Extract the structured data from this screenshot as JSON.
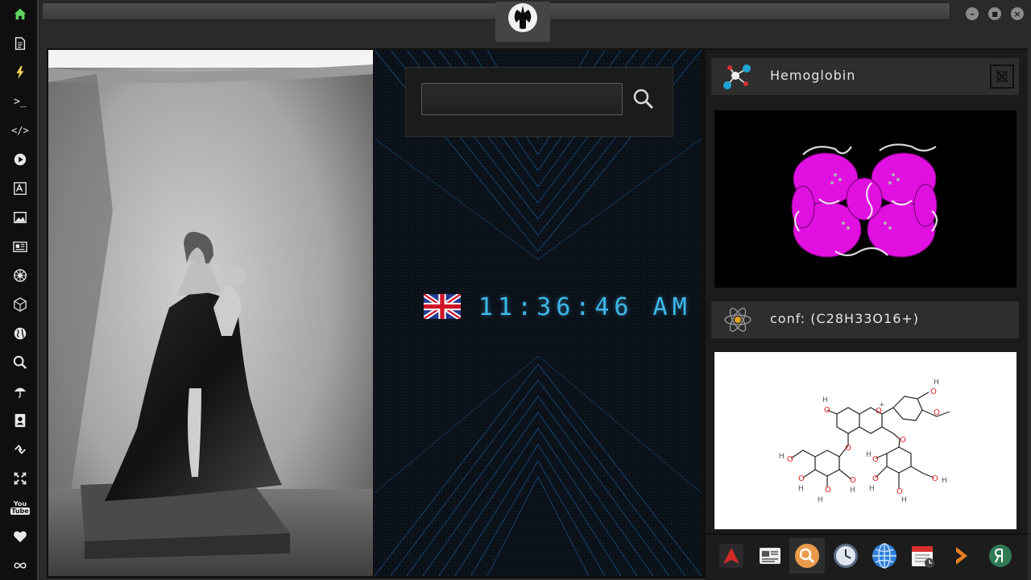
{
  "sidebar": {
    "items": [
      {
        "name": "home",
        "glyph": "⌂",
        "color": "#5fd35f"
      },
      {
        "name": "document",
        "glyph": "▤"
      },
      {
        "name": "bolt",
        "glyph": "⚡",
        "color": "#f2d35a"
      },
      {
        "name": "terminal",
        "glyph": ">_"
      },
      {
        "name": "code",
        "glyph": "</>"
      },
      {
        "name": "play",
        "glyph": "▶"
      },
      {
        "name": "translate",
        "glyph": "文"
      },
      {
        "name": "image",
        "glyph": "▣"
      },
      {
        "name": "news",
        "glyph": "☰"
      },
      {
        "name": "empire",
        "glyph": "✺"
      },
      {
        "name": "cube",
        "glyph": "⬡"
      },
      {
        "name": "globe",
        "glyph": "◍"
      },
      {
        "name": "search",
        "glyph": "⌕"
      },
      {
        "name": "umbrella",
        "glyph": "☂"
      },
      {
        "name": "contacts",
        "glyph": "▦"
      },
      {
        "name": "link",
        "glyph": "◈"
      },
      {
        "name": "expand",
        "glyph": "✜"
      },
      {
        "name": "youtube",
        "glyph": "You Tube"
      },
      {
        "name": "heart",
        "glyph": "♥"
      },
      {
        "name": "infinity",
        "glyph": "∞"
      }
    ]
  },
  "window": {
    "controls": [
      "–",
      "■",
      "×"
    ]
  },
  "search": {
    "value": "",
    "placeholder": ""
  },
  "clock": {
    "time": "11:36:46 AM",
    "flag": "United Kingdom"
  },
  "protein": {
    "title": "Hemoglobin"
  },
  "compound": {
    "title": "conf: (C28H33O16+)"
  },
  "colors": {
    "accent_clock": "#3db8e8",
    "protein_ribbon": "#e010e0",
    "sidebar_home": "#5fd35f"
  },
  "dock": {
    "items": [
      "arch-linux",
      "news-reader",
      "search",
      "clock",
      "browser",
      "calendar",
      "arrow",
      "yandex"
    ]
  }
}
